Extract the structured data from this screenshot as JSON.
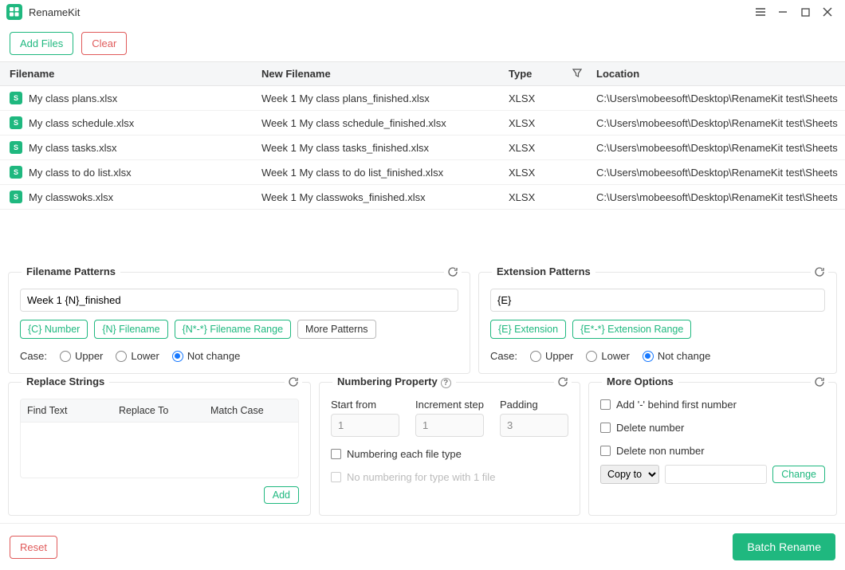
{
  "app": {
    "name": "RenameKit"
  },
  "toolbar": {
    "add_files": "Add Files",
    "clear": "Clear"
  },
  "table": {
    "headers": {
      "filename": "Filename",
      "new_filename": "New Filename",
      "type": "Type",
      "location": "Location"
    },
    "rows": [
      {
        "filename": "My class plans.xlsx",
        "new": "Week 1 My class plans_finished.xlsx",
        "type": "XLSX",
        "loc": "C:\\Users\\mobeesoft\\Desktop\\RenameKit test\\Sheets"
      },
      {
        "filename": "My class schedule.xlsx",
        "new": "Week 1 My class schedule_finished.xlsx",
        "type": "XLSX",
        "loc": "C:\\Users\\mobeesoft\\Desktop\\RenameKit test\\Sheets"
      },
      {
        "filename": "My class tasks.xlsx",
        "new": "Week 1 My class tasks_finished.xlsx",
        "type": "XLSX",
        "loc": "C:\\Users\\mobeesoft\\Desktop\\RenameKit test\\Sheets"
      },
      {
        "filename": "My class to do list.xlsx",
        "new": "Week 1 My class to do list_finished.xlsx",
        "type": "XLSX",
        "loc": "C:\\Users\\mobeesoft\\Desktop\\RenameKit test\\Sheets"
      },
      {
        "filename": "My classwoks.xlsx",
        "new": "Week 1 My classwoks_finished.xlsx",
        "type": "XLSX",
        "loc": "C:\\Users\\mobeesoft\\Desktop\\RenameKit test\\Sheets"
      }
    ]
  },
  "filename_patterns": {
    "title": "Filename Patterns",
    "value": "Week 1 {N}_finished",
    "chips": {
      "c_number": "{C} Number",
      "n_filename": "{N} Filename",
      "n_range": "{N*-*} Filename Range",
      "more": "More Patterns"
    },
    "case_label": "Case:",
    "case_options": {
      "upper": "Upper",
      "lower": "Lower",
      "not_change": "Not change"
    }
  },
  "extension_patterns": {
    "title": "Extension Patterns",
    "value": "{E}",
    "chips": {
      "e_ext": "{E} Extension",
      "e_range": "{E*-*} Extension Range"
    },
    "case_label": "Case:",
    "case_options": {
      "upper": "Upper",
      "lower": "Lower",
      "not_change": "Not change"
    }
  },
  "replace_strings": {
    "title": "Replace Strings",
    "headers": {
      "find": "Find Text",
      "replace": "Replace To",
      "match": "Match Case"
    },
    "add": "Add"
  },
  "numbering": {
    "title": "Numbering Property",
    "start_from_label": "Start from",
    "start_from": "1",
    "increment_label": "Increment step",
    "increment": "1",
    "padding_label": "Padding",
    "padding": "3",
    "each_type": "Numbering each file type",
    "no_number_single": "No numbering for type with 1 file"
  },
  "more_options": {
    "title": "More Options",
    "add_dash": "Add '-' behind first number",
    "delete_number": "Delete number",
    "delete_non_number": "Delete non number",
    "copy_to": "Copy to",
    "change": "Change"
  },
  "bottom": {
    "reset": "Reset",
    "batch_rename": "Batch Rename"
  }
}
